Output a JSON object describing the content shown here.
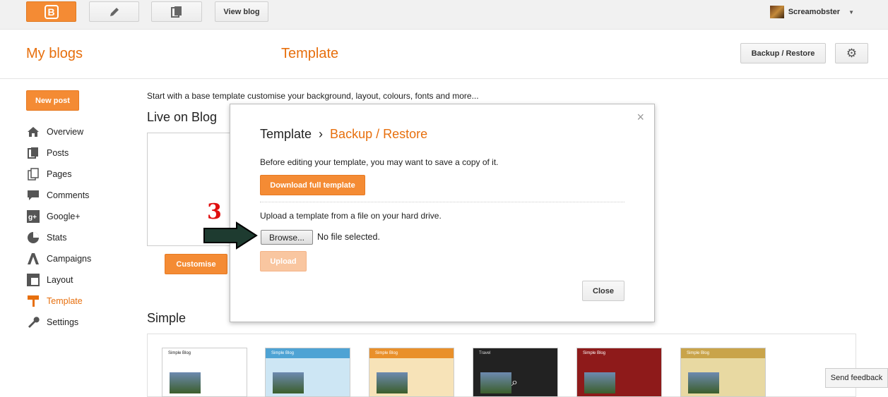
{
  "topbar": {
    "view_blog_label": "View blog",
    "user_name": "Screamobster",
    "caret": "▼"
  },
  "header": {
    "my_blogs_label": "My blogs",
    "page_title": "Template",
    "backup_restore_label": "Backup / Restore"
  },
  "sidebar": {
    "new_post_label": "New post",
    "items": [
      {
        "label": "Overview",
        "icon": "home-icon"
      },
      {
        "label": "Posts",
        "icon": "posts-icon"
      },
      {
        "label": "Pages",
        "icon": "pages-icon"
      },
      {
        "label": "Comments",
        "icon": "comments-icon"
      },
      {
        "label": "Google+",
        "icon": "google-plus-icon"
      },
      {
        "label": "Stats",
        "icon": "stats-icon"
      },
      {
        "label": "Campaigns",
        "icon": "campaigns-icon"
      },
      {
        "label": "Layout",
        "icon": "layout-icon"
      },
      {
        "label": "Template",
        "icon": "template-icon"
      },
      {
        "label": "Settings",
        "icon": "settings-icon"
      }
    ],
    "active_item": "Template"
  },
  "main": {
    "intro_text": "Start with a base template customise your background, layout, colours, fonts and more...",
    "live_heading": "Live on Blog",
    "customise_label": "Customise",
    "simple_heading": "Simple",
    "thumbnails": [
      "Simple Blog",
      "Simple Blog",
      "Simple Blog",
      "Travel",
      "Simple Blog",
      "Simple Blog"
    ]
  },
  "modal": {
    "title_main": "Template",
    "title_sep": "›",
    "title_sub": "Backup / Restore",
    "save_text": "Before editing your template, you may want to save a copy of it.",
    "download_label": "Download full template",
    "upload_text": "Upload a template from a file on your hard drive.",
    "browse_label": "Browse...",
    "no_file_text": "No file selected.",
    "upload_label": "Upload",
    "close_label": "Close",
    "close_x": "×"
  },
  "annotation": {
    "step_number": "3"
  },
  "feedback_label": "Send feedback",
  "colors": {
    "accent": "#e76f0d",
    "button_orange": "#f48b34",
    "annotation_red": "#e01010"
  }
}
